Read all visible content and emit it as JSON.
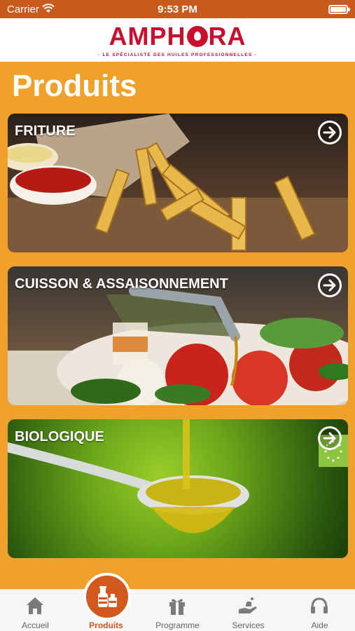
{
  "status_bar": {
    "carrier": "Carrier",
    "time": "9:53 PM"
  },
  "brand": {
    "logo_left": "AMPH",
    "logo_right": "RA",
    "tagline": "- LE SPÉCIALISTE DES HUILES PROFESSIONNELLES -"
  },
  "page": {
    "title": "Produits"
  },
  "cards": [
    {
      "label": "FRITURE"
    },
    {
      "label": "CUISSON & ASSAISONNEMENT"
    },
    {
      "label": "BIOLOGIQUE"
    }
  ],
  "tabs": [
    {
      "label": "Accueil",
      "icon": "home-icon"
    },
    {
      "label": "Produits",
      "icon": "oil-bottles-icon"
    },
    {
      "label": "Programme",
      "icon": "gift-icon"
    },
    {
      "label": "Services",
      "icon": "hand-service-icon"
    },
    {
      "label": "Aide",
      "icon": "headset-icon"
    }
  ],
  "colors": {
    "accent": "#d2581e",
    "background": "#f0a12a",
    "brand": "#c8102e"
  }
}
